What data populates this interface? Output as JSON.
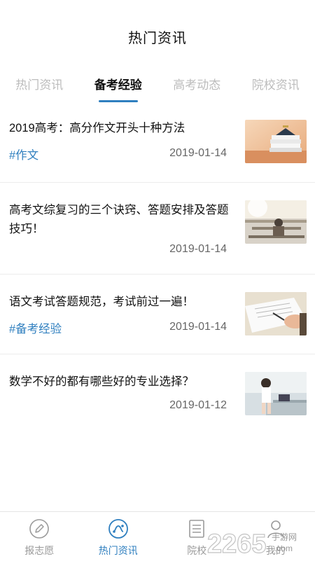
{
  "header": {
    "title": "热门资讯"
  },
  "tabs": [
    {
      "label": "热门资讯"
    },
    {
      "label": "备考经验"
    },
    {
      "label": "高考动态"
    },
    {
      "label": "院校资讯"
    }
  ],
  "articles": [
    {
      "title": "2019高考：高分作文开头十种方法",
      "tag": "#作文",
      "date": "2019-01-14",
      "thumb_icon": "books-photo"
    },
    {
      "title": "高考文综复习的三个诀窍、答题安排及答题技巧！",
      "tag": "",
      "date": "2019-01-14",
      "thumb_icon": "classroom-photo"
    },
    {
      "title": "语文考试答题规范，考试前过一遍！",
      "tag": "#备考经验",
      "date": "2019-01-14",
      "thumb_icon": "writing-photo"
    },
    {
      "title": "数学不好的都有哪些好的专业选择？",
      "tag": "",
      "date": "2019-01-12",
      "thumb_icon": "student-photo"
    }
  ],
  "bottom_nav": [
    {
      "label": "报志愿",
      "icon": "pencil-icon"
    },
    {
      "label": "热门资讯",
      "icon": "news-icon"
    },
    {
      "label": "院校",
      "icon": "school-list-icon"
    },
    {
      "label": "我的",
      "icon": "user-icon"
    }
  ],
  "watermark": {
    "text": "2265",
    "sub": "手游网",
    "domain": ".com"
  },
  "colors": {
    "accent": "#2f7fbf",
    "inactive": "#bcbcbc",
    "date": "#666666"
  }
}
